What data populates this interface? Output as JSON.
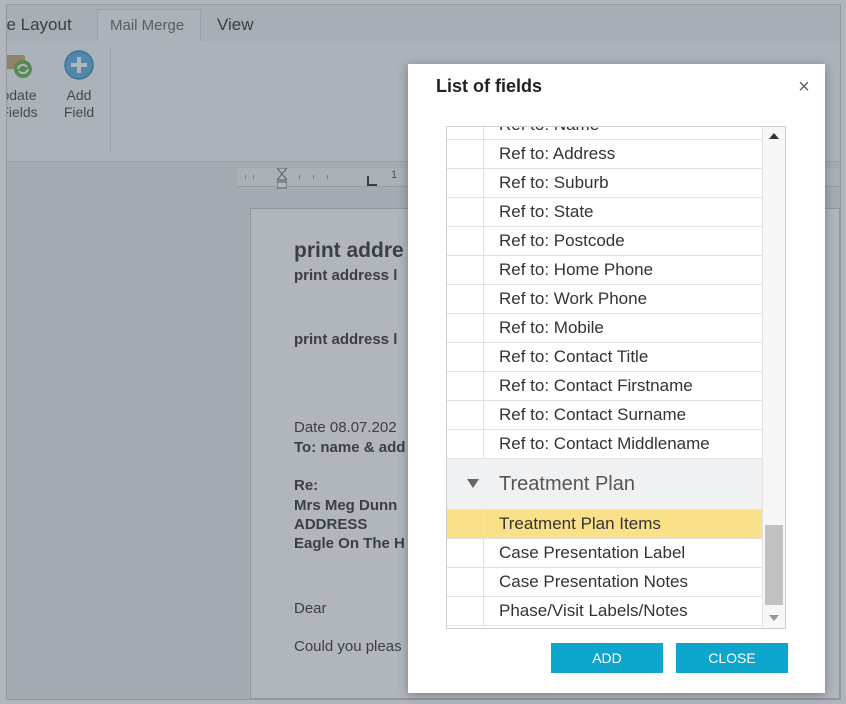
{
  "tabs": [
    "ge Layout",
    "Mail Merge",
    "View"
  ],
  "ribbon": {
    "update_label_1": "odate",
    "update_label_2": "Fields",
    "add_label_1": "Add",
    "add_label_2": "Field"
  },
  "ruler": {
    "number": "1"
  },
  "document": {
    "heading": "print addre",
    "subline1": "print address l",
    "subline2": "print address l",
    "date": "Date  08.07.202",
    "to": "To: name & add",
    "re": "Re:",
    "patient": "Mrs  Meg Dunn",
    "address": "ADDRESS",
    "suburb": "Eagle On The H",
    "dear": "Dear",
    "body": "Could you pleas"
  },
  "dialog": {
    "title": "List of fields",
    "close_glyph": "×",
    "rows": [
      "Ref to: Name",
      "Ref to: Address",
      "Ref to: Suburb",
      "Ref to: State",
      "Ref to: Postcode",
      "Ref to: Home Phone",
      "Ref to: Work Phone",
      "Ref to: Mobile",
      "Ref to: Contact Title",
      "Ref to: Contact Firstname",
      "Ref to: Contact Surname",
      "Ref to: Contact Middlename"
    ],
    "group_label": "Treatment Plan",
    "group_rows": [
      "Treatment Plan Items",
      "Case Presentation Label",
      "Case Presentation Notes",
      "Phase/Visit Labels/Notes"
    ],
    "selected_item": "Treatment Plan Items",
    "add_button": "ADD",
    "close_button": "CLOSE"
  },
  "colors": {
    "accent": "#0fa6cd",
    "selection": "#fbe08a"
  }
}
